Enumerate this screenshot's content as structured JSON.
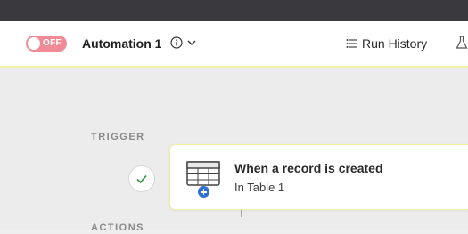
{
  "header": {
    "toggle_label": "OFF",
    "title": "Automation 1",
    "run_history_label": "Run History"
  },
  "canvas": {
    "trigger_label": "TRIGGER",
    "actions_label": "ACTIONS",
    "trigger_card": {
      "title": "When a record is created",
      "subtitle": "In Table 1"
    }
  },
  "colors": {
    "toggle_off": "#f08a97",
    "accent_blue": "#2e6fd8",
    "check_green": "#2f8f3a",
    "highlight": "#f1eea6"
  },
  "icons": {
    "info": "info-icon",
    "chevron": "chevron-down-icon",
    "run_history": "list-icon",
    "flask": "flask-icon",
    "check": "check-icon",
    "table": "table-icon",
    "add": "plus-icon"
  }
}
